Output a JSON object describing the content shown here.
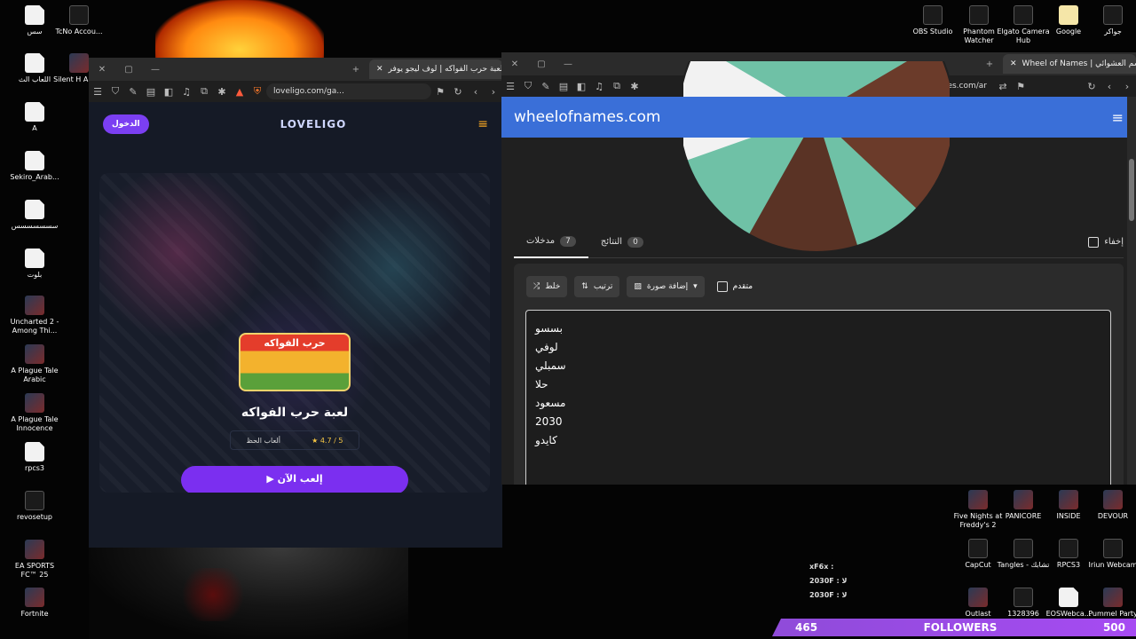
{
  "desktop": {
    "left_icons": [
      {
        "label": "سس",
        "icon": "doc-icon"
      },
      {
        "label": "اللعاب الث",
        "icon": "doc-icon"
      },
      {
        "label": "A",
        "icon": "doc-icon"
      },
      {
        "label": "Sekiro_Arab...",
        "icon": "doc-icon"
      },
      {
        "label": "سسسسسسس",
        "icon": "doc-icon"
      },
      {
        "label": "بلوت",
        "icon": "doc-icon"
      },
      {
        "label": "Uncharted 2 - Among Thi...",
        "icon": "game-icon"
      },
      {
        "label": "A Plague Tale Arabic",
        "icon": "game-icon"
      },
      {
        "label": "A Plague Tale Innocence",
        "icon": "game-icon"
      },
      {
        "label": "rpcs3",
        "icon": "doc-icon"
      },
      {
        "label": "revosetup",
        "icon": "app-icon"
      },
      {
        "label": "EA SPORTS FC™ 25",
        "icon": "game-icon"
      },
      {
        "label": "Fortnite",
        "icon": "game-icon"
      }
    ],
    "col2_icons": [
      {
        "label": "TcNo Accou...",
        "icon": "app-icon"
      },
      {
        "label": "Silent H ARABI",
        "icon": "game-icon"
      }
    ],
    "top_right_icons": [
      {
        "label": "OBS Studio",
        "icon": "obs-icon"
      },
      {
        "label": "Phantom Watcher",
        "icon": "app-icon"
      },
      {
        "label": "Elgato Camera Hub",
        "icon": "camera-icon"
      },
      {
        "label": "Google",
        "icon": "google-icon"
      },
      {
        "label": "جواكر",
        "icon": "app-icon"
      }
    ],
    "bottom_right_icons": [
      {
        "label": "Five Nights at Freddy's 2",
        "icon": "game-icon"
      },
      {
        "label": "PANICORE",
        "icon": "game-icon"
      },
      {
        "label": "INSIDE",
        "icon": "game-icon"
      },
      {
        "label": "DEVOUR",
        "icon": "game-icon"
      },
      {
        "label": "CapCut",
        "icon": "app-icon"
      },
      {
        "label": "Tangles - تشابك",
        "icon": "app-icon"
      },
      {
        "label": "RPCS3",
        "icon": "app-icon"
      },
      {
        "label": "Iriun Webcam",
        "icon": "camera-icon"
      },
      {
        "label": "Outlast",
        "icon": "game-icon"
      },
      {
        "label": "1328396",
        "icon": "app-icon"
      },
      {
        "label": "EOSWebca...",
        "icon": "doc-icon"
      },
      {
        "label": "Pummel Party",
        "icon": "game-icon"
      }
    ]
  },
  "left_window": {
    "tab_title": "لعبة حرب الفواكه | لوف ليجو يوفر",
    "url": "loveligo.com/ga...",
    "login_label": "الدخول",
    "logo_text": "LOVELIGO",
    "thumb_text": "حرب الفواكه",
    "game_title": "لعبة حرب الفواكه",
    "rating": "4.7 / 5",
    "category": "ألعاب الحظ",
    "play_label": "إلعب الآن"
  },
  "right_window": {
    "tab_title": "Wheel of Names | اسم العشوائي",
    "url": "wheelofnames.com/ar",
    "brand": "wheelofnames.com",
    "tabs": [
      {
        "label": "مدخلات",
        "count": "7"
      },
      {
        "label": "النتائج",
        "count": "0"
      }
    ],
    "hide_label": "إخفاء",
    "tools": {
      "shuffle": "خلط",
      "sort": "ترتيب",
      "add_image": "إضافة صورة",
      "advanced": "متقدم"
    },
    "entries": [
      "بسسو",
      "لوفي",
      "سمبلي",
      "حلا",
      "مسعود",
      "2030",
      "كايدو"
    ]
  },
  "stream": {
    "followers_current": "465",
    "followers_label": "FOLLOWERS",
    "followers_goal": "500",
    "chat_lines": [
      "xF6x :",
      "2030F : لا",
      "2030F : لا"
    ]
  }
}
